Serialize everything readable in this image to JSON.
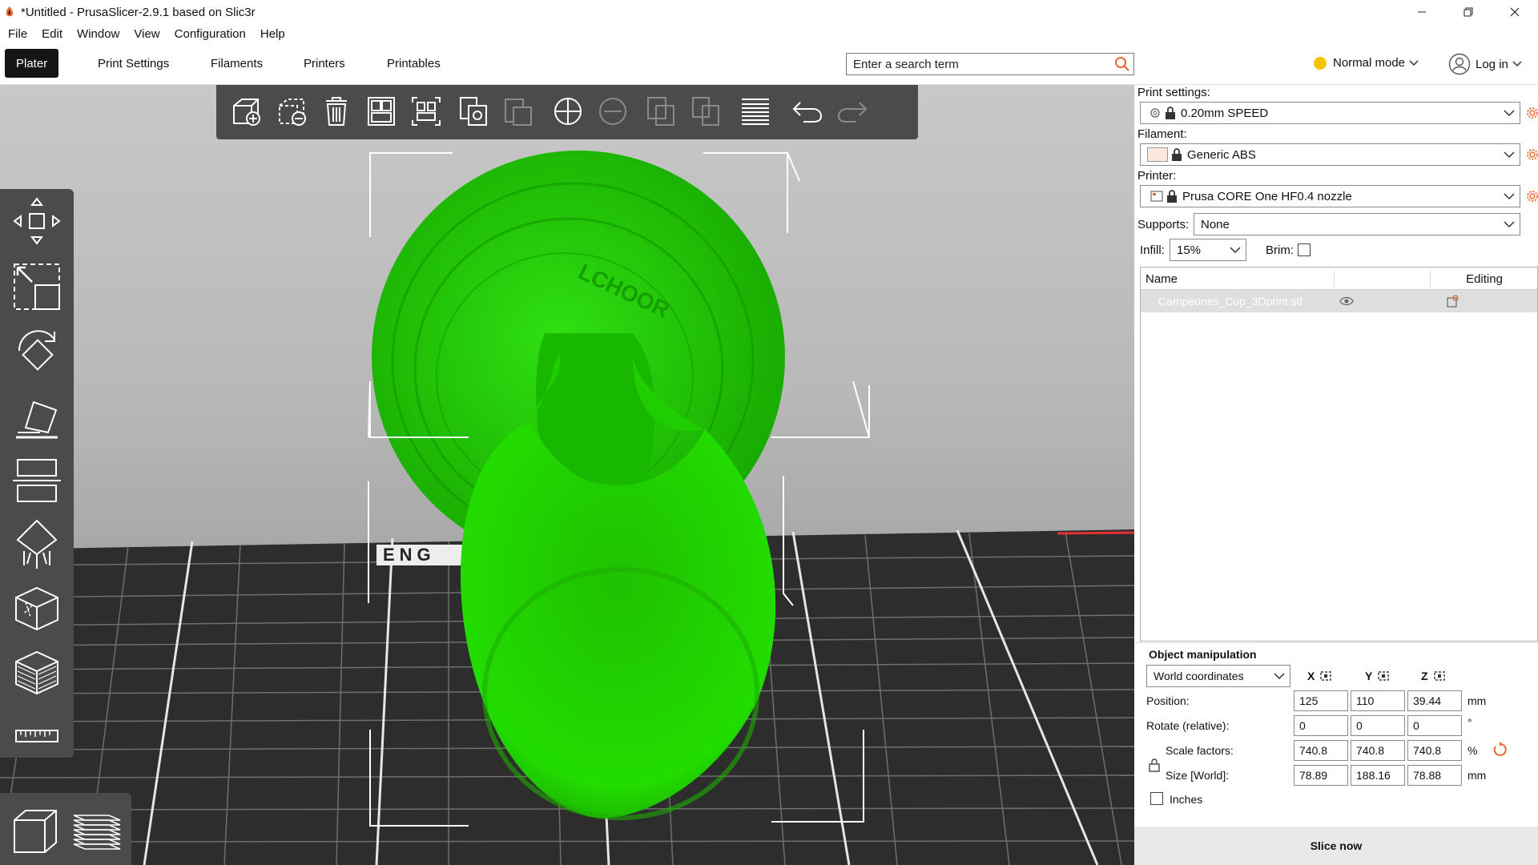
{
  "window": {
    "title": "*Untitled - PrusaSlicer-2.9.1 based on Slic3r"
  },
  "menu": [
    "File",
    "Edit",
    "Window",
    "View",
    "Configuration",
    "Help"
  ],
  "tabs": [
    "Plater",
    "Print Settings",
    "Filaments",
    "Printers",
    "Printables"
  ],
  "search": {
    "placeholder": "Enter a search term"
  },
  "mode": {
    "label": "Normal mode",
    "indicator_color": "#f5c400"
  },
  "account": {
    "label": "Log in"
  },
  "viewport": {
    "model_color": "#22dd00",
    "bed_label": "ENG"
  },
  "panel": {
    "print_settings": {
      "label": "Print settings:",
      "value": "0.20mm SPEED"
    },
    "filament": {
      "label": "Filament:",
      "value": "Generic ABS",
      "swatch_color": "#fbe7dc"
    },
    "printer": {
      "label": "Printer:",
      "value": "Prusa CORE One HF0.4 nozzle"
    },
    "supports": {
      "label": "Supports:",
      "value": "None"
    },
    "infill": {
      "label": "Infill:",
      "value": "15%"
    },
    "brim": {
      "label": "Brim:",
      "checked": false
    },
    "object_list": {
      "col_name": "Name",
      "col_editing": "Editing",
      "rows": [
        {
          "name": "Campeones_Cup_3Dprint.stl"
        }
      ]
    },
    "object_manipulation": {
      "title": "Object manipulation",
      "coord_system": "World coordinates",
      "axes": [
        "X",
        "Y",
        "Z"
      ],
      "position": {
        "label": "Position:",
        "values": [
          "125",
          "110",
          "39.44"
        ],
        "unit": "mm"
      },
      "rotate": {
        "label": "Rotate (relative):",
        "values": [
          "0",
          "0",
          "0"
        ],
        "unit": "°"
      },
      "scale": {
        "label": "Scale factors:",
        "values": [
          "740.8",
          "740.8",
          "740.8"
        ],
        "unit": "%"
      },
      "size": {
        "label": "Size [World]:",
        "values": [
          "78.89",
          "188.16",
          "78.88"
        ],
        "unit": "mm"
      },
      "inches": {
        "label": "Inches",
        "checked": false
      }
    },
    "slice_button": "Slice now"
  }
}
